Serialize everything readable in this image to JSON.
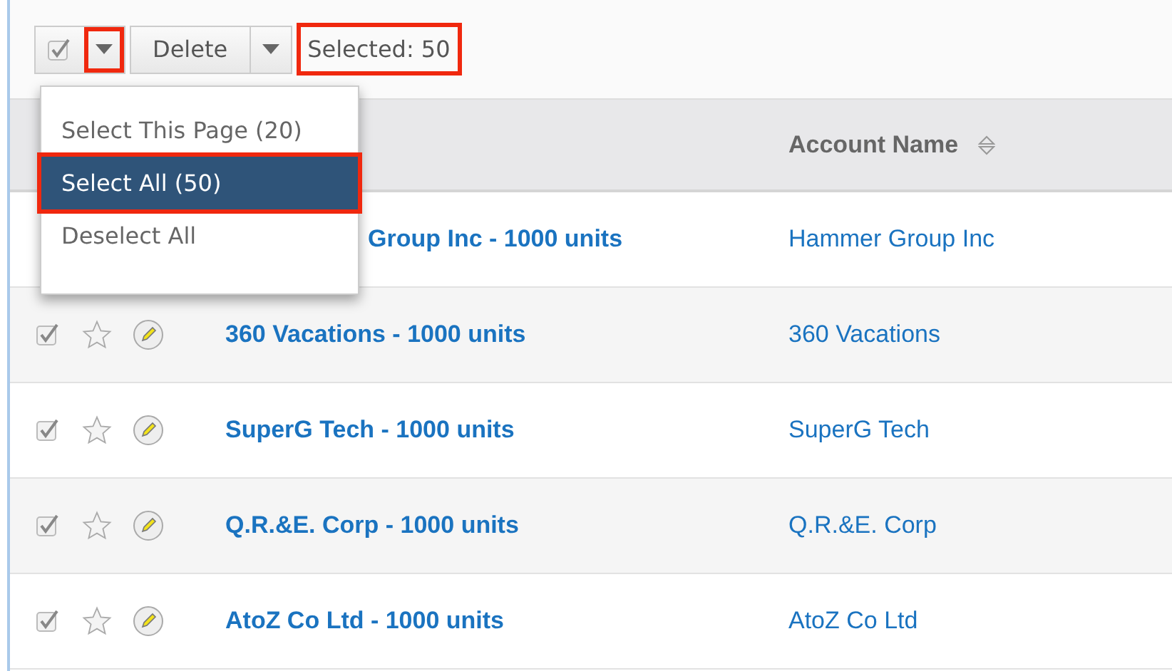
{
  "toolbar": {
    "select_checkbox": {
      "checked": true
    },
    "select_caret": {
      "highlighted": true
    },
    "delete_button": {
      "label": "Delete"
    },
    "selected_count": {
      "text": "Selected:  50",
      "highlighted": true
    }
  },
  "menu": {
    "items": [
      {
        "label": "Select This Page (20)",
        "selected": false,
        "highlighted": false
      },
      {
        "label": "Select All (50)",
        "selected": true,
        "highlighted": true
      },
      {
        "label": "Deselect All",
        "selected": false,
        "highlighted": false
      }
    ]
  },
  "table": {
    "columns": [
      {
        "label": "Account Name"
      }
    ],
    "rows": [
      {
        "name": "Group Inc - 1000 units",
        "account": "Hammer Group Inc",
        "covered": true
      },
      {
        "name": "360 Vacations - 1000 units",
        "account": "360 Vacations",
        "checked": true,
        "covered": false
      },
      {
        "name": "SuperG Tech - 1000 units",
        "account": "SuperG Tech",
        "checked": true,
        "covered": false
      },
      {
        "name": "Q.R.&E. Corp - 1000 units",
        "account": "Q.R.&E. Corp",
        "checked": true,
        "covered": false
      },
      {
        "name": "AtoZ Co Ltd - 1000 units",
        "account": "AtoZ Co Ltd",
        "checked": true,
        "covered": false
      }
    ]
  }
}
